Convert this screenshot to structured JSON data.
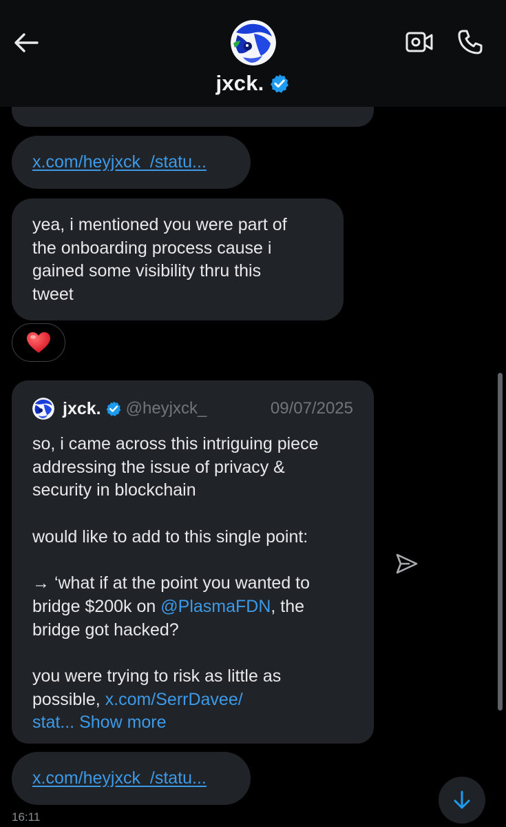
{
  "header": {
    "name": "jxck.",
    "verified": true,
    "back_icon": "arrow-left-icon",
    "video_icon": "video-call-icon",
    "phone_icon": "phone-call-icon"
  },
  "messages": {
    "link1": "x.com/heyjxck_/statu...",
    "text1_lines": [
      "yea, i mentioned you were part of",
      "the onboarding process cause i",
      "gained some visibility thru this",
      "tweet"
    ],
    "reaction_icon": "red-heart-emoji",
    "quote": {
      "name": "jxck.",
      "handle": "@heyjxck_",
      "date": "09/07/2025",
      "line1": "so, i came across this intriguing piece",
      "line2": "addressing the issue of privacy &",
      "line3": "security in blockchain",
      "line4": "would like to add to this single point:",
      "line5": "→ ‘what if at the point you wanted to",
      "line6_pre": "bridge $200k on ",
      "line6_mention": "@PlasmaFDN",
      "line6_post": ", the",
      "line7": "bridge got hacked?",
      "line8": "you were trying to risk as little as",
      "line9_pre": "possible, ",
      "line9_link": "x.com/SerrDavee/",
      "line10_link": "stat...",
      "line10_more": "Show more"
    },
    "link2": "x.com/heyjxck_/statu...",
    "timestamp": "16:11"
  },
  "colors": {
    "background": "#000000",
    "bubble": "#202327",
    "link": "#3c9ae8",
    "verified": "#1d9bf0",
    "muted": "#71767b"
  }
}
